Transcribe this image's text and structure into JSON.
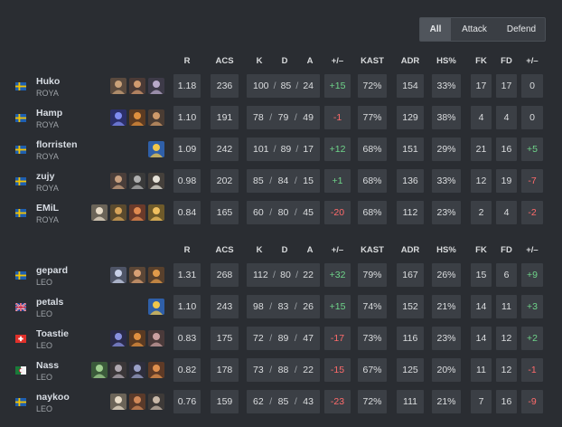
{
  "filters": {
    "all": "All",
    "attack": "Attack",
    "defend": "Defend",
    "active": "all"
  },
  "columns": [
    "R",
    "ACS",
    "K",
    "D",
    "A",
    "+/–",
    "KAST",
    "ADR",
    "HS%",
    "FK",
    "FD",
    "+/–"
  ],
  "teams": [
    {
      "players": [
        {
          "name": "Huko",
          "team": "ROYA",
          "flag": "sweden",
          "agents": [
            "agent-a",
            "agent-b",
            "agent-c"
          ],
          "r": "1.18",
          "acs": "236",
          "k": "100",
          "d": "85",
          "a": "24",
          "kd_diff": "+15",
          "kast": "72%",
          "adr": "154",
          "hs": "33%",
          "fk": "17",
          "fd": "17",
          "fk_diff": "0"
        },
        {
          "name": "Hamp",
          "team": "ROYA",
          "flag": "sweden",
          "agents": [
            "agent-d",
            "agent-e",
            "agent-f"
          ],
          "r": "1.10",
          "acs": "191",
          "k": "78",
          "d": "79",
          "a": "49",
          "kd_diff": "-1",
          "kast": "77%",
          "adr": "129",
          "hs": "38%",
          "fk": "4",
          "fd": "4",
          "fk_diff": "0"
        },
        {
          "name": "florristen",
          "team": "ROYA",
          "flag": "sweden",
          "agents": [
            "agent-g"
          ],
          "r": "1.09",
          "acs": "242",
          "k": "101",
          "d": "89",
          "a": "17",
          "kd_diff": "+12",
          "kast": "68%",
          "adr": "151",
          "hs": "29%",
          "fk": "21",
          "fd": "16",
          "fk_diff": "+5"
        },
        {
          "name": "zujy",
          "team": "ROYA",
          "flag": "sweden",
          "agents": [
            "agent-h",
            "agent-i",
            "agent-j"
          ],
          "r": "0.98",
          "acs": "202",
          "k": "85",
          "d": "84",
          "a": "15",
          "kd_diff": "+1",
          "kast": "68%",
          "adr": "136",
          "hs": "33%",
          "fk": "12",
          "fd": "19",
          "fk_diff": "-7"
        },
        {
          "name": "EMiL",
          "team": "ROYA",
          "flag": "sweden",
          "agents": [
            "agent-k",
            "agent-l",
            "agent-m",
            "agent-n"
          ],
          "r": "0.84",
          "acs": "165",
          "k": "60",
          "d": "80",
          "a": "45",
          "kd_diff": "-20",
          "kast": "68%",
          "adr": "112",
          "hs": "23%",
          "fk": "2",
          "fd": "4",
          "fk_diff": "-2"
        }
      ]
    },
    {
      "players": [
        {
          "name": "gepard",
          "team": "LEO",
          "flag": "sweden",
          "agents": [
            "agent-o",
            "agent-p",
            "agent-q"
          ],
          "r": "1.31",
          "acs": "268",
          "k": "112",
          "d": "80",
          "a": "22",
          "kd_diff": "+32",
          "kast": "79%",
          "adr": "167",
          "hs": "26%",
          "fk": "15",
          "fd": "6",
          "fk_diff": "+9"
        },
        {
          "name": "petals",
          "team": "LEO",
          "flag": "uk",
          "agents": [
            "agent-g"
          ],
          "r": "1.10",
          "acs": "243",
          "k": "98",
          "d": "83",
          "a": "26",
          "kd_diff": "+15",
          "kast": "74%",
          "adr": "152",
          "hs": "21%",
          "fk": "14",
          "fd": "11",
          "fk_diff": "+3"
        },
        {
          "name": "Toastie",
          "team": "LEO",
          "flag": "switzerland",
          "agents": [
            "agent-r",
            "agent-s",
            "agent-t"
          ],
          "r": "0.83",
          "acs": "175",
          "k": "72",
          "d": "89",
          "a": "47",
          "kd_diff": "-17",
          "kast": "73%",
          "adr": "116",
          "hs": "23%",
          "fk": "14",
          "fd": "12",
          "fk_diff": "+2"
        },
        {
          "name": "Nass",
          "team": "LEO",
          "flag": "algeria",
          "agents": [
            "agent-u",
            "agent-v",
            "agent-w",
            "agent-x"
          ],
          "r": "0.82",
          "acs": "178",
          "k": "73",
          "d": "88",
          "a": "22",
          "kd_diff": "-15",
          "kast": "67%",
          "adr": "125",
          "hs": "20%",
          "fk": "11",
          "fd": "12",
          "fk_diff": "-1"
        },
        {
          "name": "naykoo",
          "team": "LEO",
          "flag": "sweden",
          "agents": [
            "agent-k",
            "agent-y",
            "agent-z"
          ],
          "r": "0.76",
          "acs": "159",
          "k": "62",
          "d": "85",
          "a": "43",
          "kd_diff": "-23",
          "kast": "72%",
          "adr": "111",
          "hs": "21%",
          "fk": "7",
          "fd": "16",
          "fk_diff": "-9"
        }
      ]
    }
  ],
  "colors": {
    "background": "#2a2d32",
    "cell": "#3b3f45",
    "positive": "#6fd58a",
    "negative": "#ff6b6b",
    "name": "#d8dde4"
  }
}
